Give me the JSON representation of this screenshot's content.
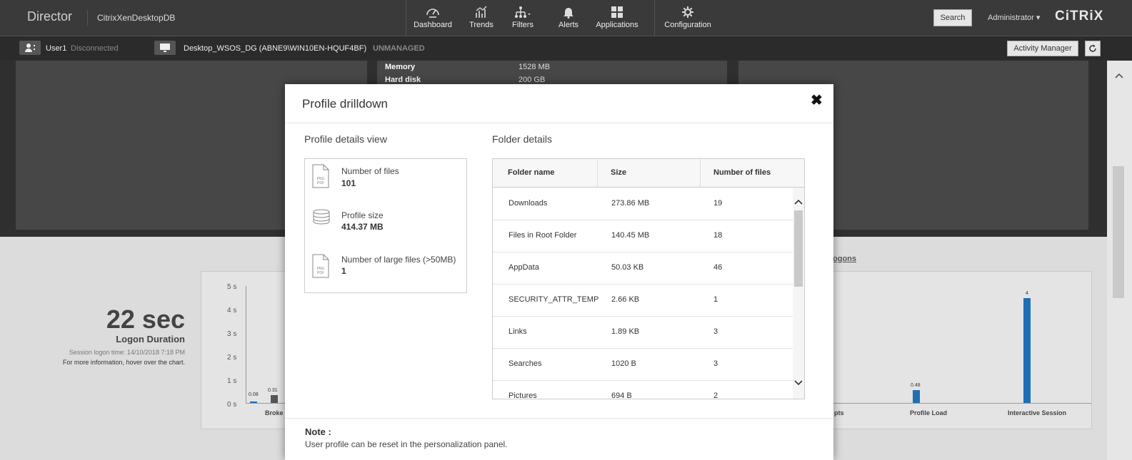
{
  "header": {
    "brand": "Director",
    "site": "CitrixXenDesktopDB",
    "nav": [
      {
        "label": "Dashboard",
        "icon": "gauge-icon"
      },
      {
        "label": "Trends",
        "icon": "trends-icon"
      },
      {
        "label": "Filters",
        "icon": "filters-icon"
      },
      {
        "label": "Alerts",
        "icon": "bell-icon"
      },
      {
        "label": "Applications",
        "icon": "grid-icon"
      },
      {
        "label": "Configuration",
        "icon": "gear-icon"
      }
    ],
    "search_label": "Search",
    "user_menu": "Administrator ▾",
    "logo": "CiTRiX"
  },
  "subbar": {
    "user_name": "User1",
    "user_status": "Disconnected",
    "machine": "Desktop_WSOS_DG (ABNE9\\WIN10EN-HQUF4BF)",
    "machine_state": "UNMANAGED",
    "activity_manager": "Activity Manager",
    "refresh_icon": "refresh-icon"
  },
  "background": {
    "memory_label": "Memory",
    "memory_value": "1528 MB",
    "disk_label": "Hard disk",
    "disk_value": "200 GB",
    "logons_heading": "Logons",
    "logon_duration_value": "22 sec",
    "logon_duration_label": "Logon Duration",
    "session_logon_time": "Session logon time: 14/10/2018 7:18 PM",
    "more_info": "For more information, hover over the chart.",
    "y_ticks": [
      "5 s",
      "4 s",
      "3 s",
      "2 s",
      "1 s",
      "0 s"
    ],
    "bar_labels": [
      "0.08",
      "0.31",
      "0.48",
      "4"
    ],
    "x_labels": [
      "Broke",
      "pts",
      "Profile Load",
      "Interactive Session"
    ]
  },
  "dialog": {
    "title": "Profile drilldown",
    "close_icon": "close-icon",
    "profile_section": "Profile details view",
    "profile_items": [
      {
        "label": "Number of files",
        "value": "101",
        "icon": "file-icon"
      },
      {
        "label": "Profile size",
        "value": "414.37 MB",
        "icon": "database-icon"
      },
      {
        "label": "Number of large files (>50MB)",
        "value": "1",
        "icon": "file-icon"
      }
    ],
    "file_icon_text": "PNG\nPDF",
    "folder_section": "Folder details",
    "columns": [
      "Folder name",
      "Size",
      "Number of files"
    ],
    "rows": [
      {
        "name": "Downloads",
        "size": "273.86 MB",
        "files": "19"
      },
      {
        "name": "Files in Root Folder",
        "size": "140.45 MB",
        "files": "18"
      },
      {
        "name": "AppData",
        "size": "50.03 KB",
        "files": "46"
      },
      {
        "name": "SECURITY_ATTR_TEMP",
        "size": "2.66 KB",
        "files": "1"
      },
      {
        "name": "Links",
        "size": "1.89 KB",
        "files": "3"
      },
      {
        "name": "Searches",
        "size": "1020 B",
        "files": "3"
      },
      {
        "name": "Pictures",
        "size": "694 B",
        "files": "2"
      }
    ],
    "note_title": "Note :",
    "note_text": "User profile can be reset in the personalization panel."
  },
  "colors": {
    "topbar": "#3a3a3a",
    "bar_blue": "#1f6fb5",
    "bar_gray": "#555555"
  }
}
